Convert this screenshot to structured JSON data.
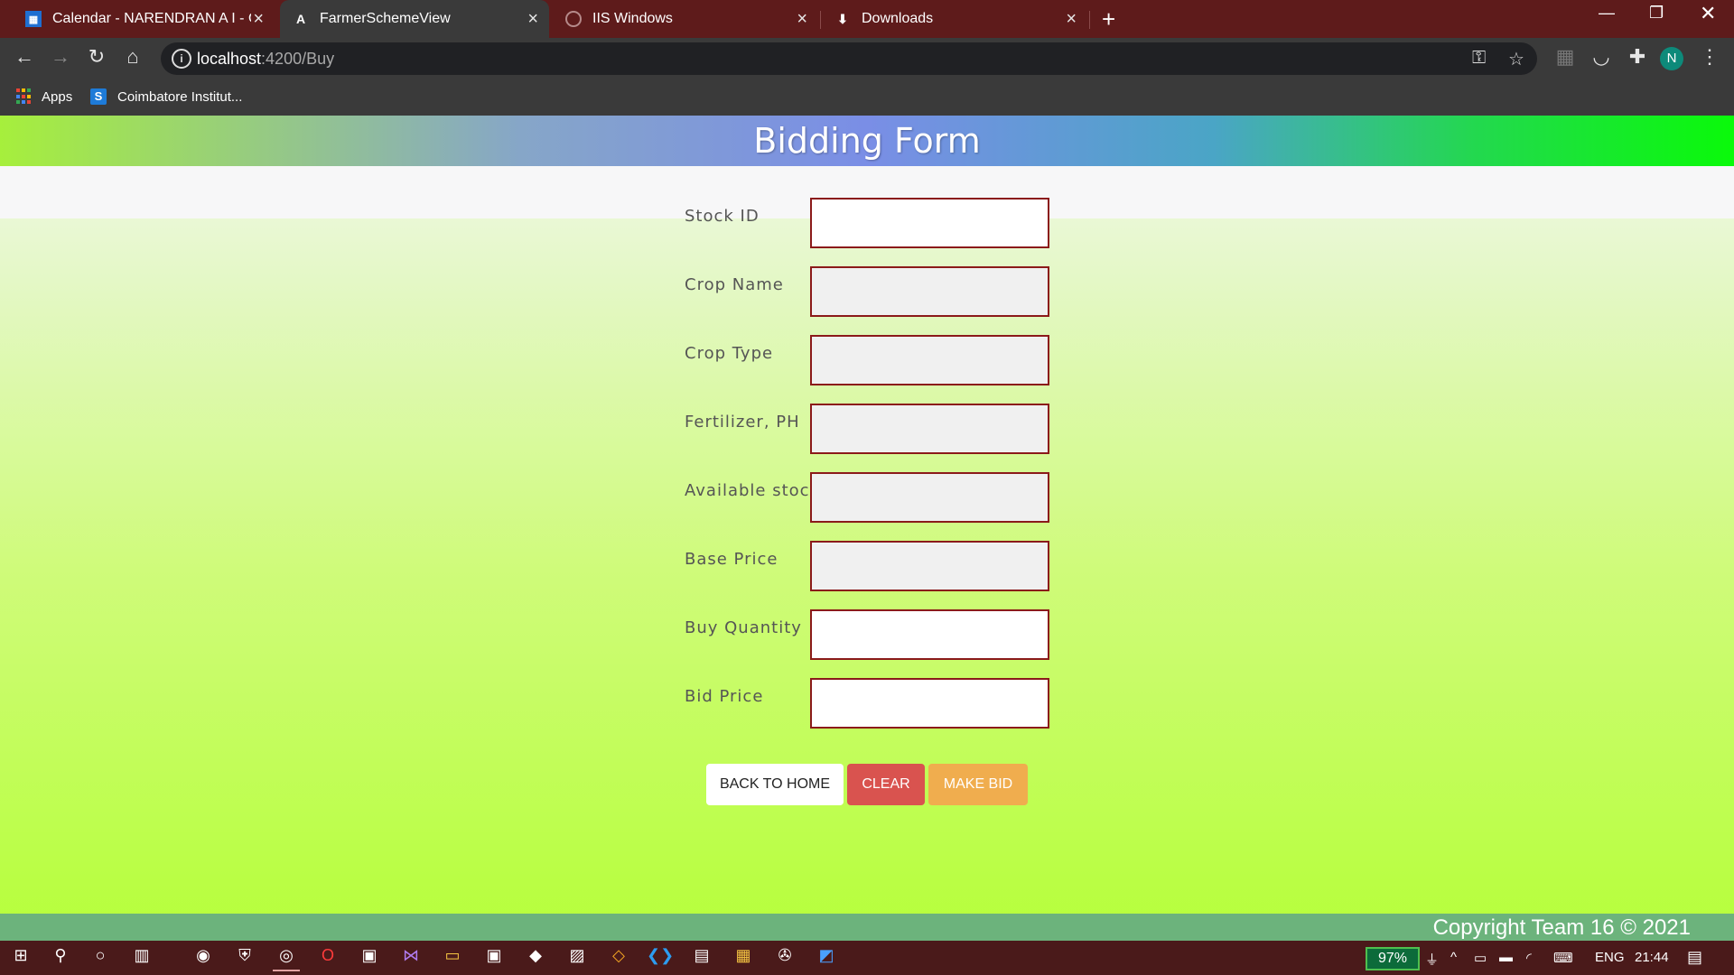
{
  "browser": {
    "tabs": [
      {
        "label": "Calendar - NARENDRAN A I - Ou",
        "icon": "calendar-icon",
        "active": false
      },
      {
        "label": "FarmerSchemeView",
        "icon": "angular-icon",
        "active": true
      },
      {
        "label": "IIS Windows",
        "icon": "globe-icon",
        "active": false
      },
      {
        "label": "Downloads",
        "icon": "download-icon",
        "active": false
      }
    ],
    "url_host": "localhost",
    "url_path": ":4200/Buy",
    "avatar_initial": "N",
    "bookmarks": [
      {
        "label": "Apps",
        "icon": "apps-grid-icon"
      },
      {
        "label": "Coimbatore Institut...",
        "icon": "s-logo-icon"
      }
    ]
  },
  "page": {
    "title": "Bidding Form",
    "fields": [
      {
        "label": "Stock ID",
        "value": "",
        "editable": true
      },
      {
        "label": "Crop Name",
        "value": "",
        "editable": false
      },
      {
        "label": "Crop Type",
        "value": "",
        "editable": false
      },
      {
        "label": "Fertilizer, PH",
        "value": "",
        "editable": false
      },
      {
        "label": "Available stock",
        "value": "",
        "editable": false
      },
      {
        "label": "Base Price",
        "value": "",
        "editable": false
      },
      {
        "label": "Buy Quantity",
        "value": "",
        "editable": true
      },
      {
        "label": "Bid Price",
        "value": "",
        "editable": true
      }
    ],
    "buttons": {
      "back": "BACK TO HOME",
      "clear": "CLEAR",
      "bid": "MAKE BID"
    },
    "footer": "Copyright Team 16 © 2021"
  },
  "taskbar": {
    "battery": "97%",
    "language": "ENG",
    "time": "21:44"
  },
  "colors": {
    "tab_strip": "#5e1b1b",
    "input_border": "#8b1a1a",
    "clear_button": "#d9534f",
    "bid_button": "#f0ad4e",
    "footer": "#6cb37c"
  }
}
